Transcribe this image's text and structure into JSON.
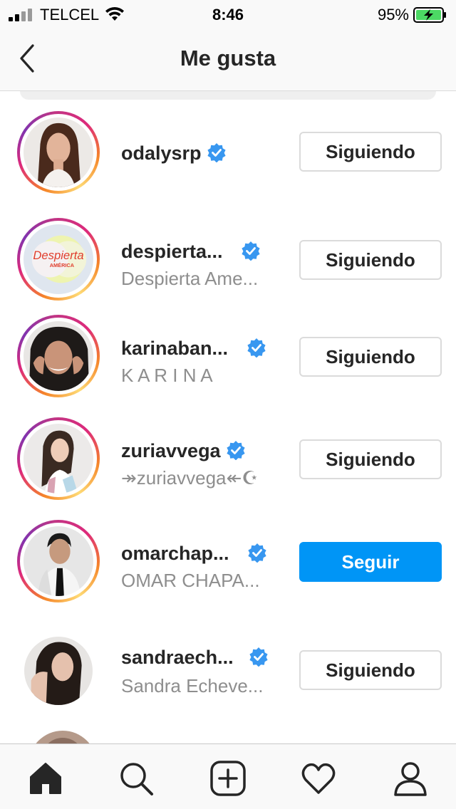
{
  "status_bar": {
    "carrier": "TELCEL",
    "time": "8:46",
    "battery_percent": "95%",
    "icons": [
      "signal-icon",
      "wifi-icon",
      "battery-charging-icon"
    ]
  },
  "header": {
    "title": "Me gusta",
    "back_icon": "chevron-left-icon"
  },
  "accounts": [
    {
      "username": "odalysrp",
      "full_name": "",
      "verified": true,
      "button": "Siguiendo",
      "following": true,
      "story_ring": true
    },
    {
      "username": "despierta...",
      "full_name": "Despierta Ame...",
      "verified": true,
      "button": "Siguiendo",
      "following": true,
      "story_ring": true,
      "logo_text": "Despierta",
      "logo_sub": "AMÉRICA"
    },
    {
      "username": "karinaban...",
      "full_name": "K A R I N A",
      "verified": true,
      "button": "Siguiendo",
      "following": true,
      "story_ring": true
    },
    {
      "username": "zuriavvega",
      "full_name": "↠zuriavvega↞☪",
      "verified": true,
      "button": "Siguiendo",
      "following": true,
      "story_ring": true
    },
    {
      "username": "omarchap...",
      "full_name": "OMAR CHAPA...",
      "verified": true,
      "button": "Seguir",
      "following": false,
      "story_ring": true
    },
    {
      "username": "sandraech...",
      "full_name": "Sandra Echeve...",
      "verified": true,
      "button": "Siguiendo",
      "following": true,
      "story_ring": false
    }
  ],
  "tab_bar": {
    "tabs": [
      "home-icon",
      "search-icon",
      "add-post-icon",
      "activity-heart-icon",
      "profile-icon"
    ],
    "active": "home-icon"
  },
  "colors": {
    "follow_blue": "#0095f6",
    "verified_blue": "#3897f0",
    "battery_green": "#4cd964",
    "text_primary": "#262626",
    "text_secondary": "#8e8e8e"
  }
}
